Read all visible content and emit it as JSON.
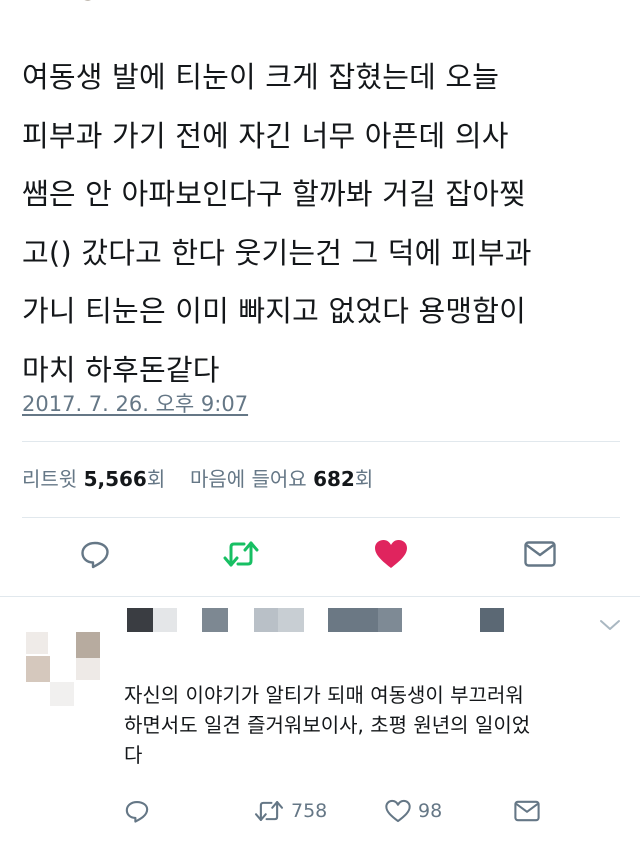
{
  "tweet": {
    "lines": [
      "여동생 발에 티눈이 크게 잡혔는데 오늘",
      "피부과 가기 전에 자긴 너무 아픈데 의사",
      "쌤은 안 아파보인다구 할까봐 거길 잡아찢",
      "고() 갔다고 한다 웃기는건 그 덕에 피부과",
      "가니 티눈은 이미 빠지고 없었다 용맹함이",
      "마치 하후돈같다"
    ],
    "timestamp": "2017. 7. 26. 오후 9:07"
  },
  "stats": {
    "retweet_label": "리트윗",
    "retweet_count": "5,566",
    "retweet_unit": "회",
    "like_label": "마음에 들어요",
    "like_count": "682",
    "like_unit": "회"
  },
  "actions": {
    "icons": [
      "reply-icon",
      "retweet-icon",
      "heart-icon",
      "message-icon"
    ],
    "retweet_color": "#17bf63",
    "like_color": "#e0245e",
    "icon_color": "#657786"
  },
  "reply": {
    "lines": [
      "자신의 이야기가 알티가 되매 여동생이 부끄러워",
      "하면서도 일견 즐거워보이사, 초평 원년의 일이었",
      "다"
    ],
    "retweet_count": "758",
    "like_count": "98"
  }
}
